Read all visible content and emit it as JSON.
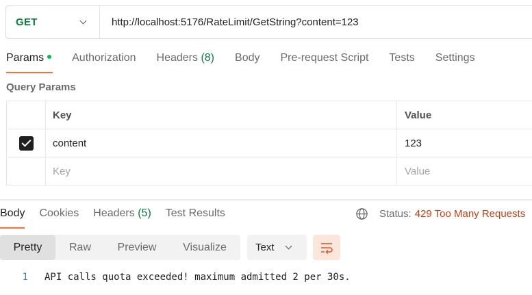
{
  "request": {
    "method": "GET",
    "url": "http://localhost:5176/RateLimit/GetString?content=123"
  },
  "request_tabs": [
    {
      "label": "Params",
      "active": true
    },
    {
      "label": "Authorization"
    },
    {
      "label": "Headers",
      "count": "(8)"
    },
    {
      "label": "Body"
    },
    {
      "label": "Pre-request Script"
    },
    {
      "label": "Tests"
    },
    {
      "label": "Settings"
    }
  ],
  "query_params": {
    "title": "Query Params",
    "headers": {
      "key": "Key",
      "value": "Value"
    },
    "rows": [
      {
        "checked": true,
        "key": "content",
        "value": "123"
      }
    ],
    "placeholder": {
      "key": "Key",
      "value": "Value"
    }
  },
  "response_tabs": [
    {
      "label": "Body",
      "active": true
    },
    {
      "label": "Cookies"
    },
    {
      "label": "Headers",
      "count": "(5)"
    },
    {
      "label": "Test Results"
    }
  ],
  "status": {
    "label": "Status:",
    "code": "429 Too Many Requests"
  },
  "view_modes": [
    {
      "label": "Pretty",
      "active": true
    },
    {
      "label": "Raw"
    },
    {
      "label": "Preview"
    },
    {
      "label": "Visualize"
    }
  ],
  "format": "Text",
  "body_lines": [
    {
      "num": "1",
      "text": "API calls quota exceeded! maximum admitted 2 per 30s."
    }
  ],
  "colors": {
    "method": "#0b7a3e",
    "accent": "#ff6c37",
    "status_error": "#c63b10",
    "params_dot": "#0cbb52"
  },
  "icons": {
    "method_dropdown": "chevron-down-icon",
    "status": "globe-icon",
    "format_dropdown": "chevron-down-icon",
    "wrap": "wrap-lines-icon",
    "checkbox": "checkmark-icon"
  }
}
